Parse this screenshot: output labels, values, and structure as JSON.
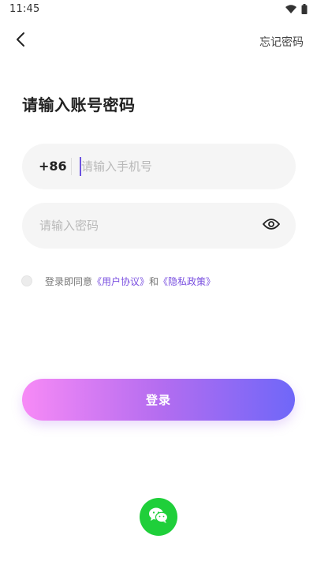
{
  "status_bar": {
    "time": "11:45",
    "wifi_icon": "wifi-icon",
    "battery_icon": "battery-icon"
  },
  "nav": {
    "back_icon": "chevron-left-icon",
    "forgot_password_label": "忘记密码"
  },
  "title": "请输入账号密码",
  "phone": {
    "country_code": "+86",
    "value": "",
    "placeholder": "请输入手机号"
  },
  "password": {
    "value": "",
    "placeholder": "请输入密码",
    "toggle_icon": "eye-icon"
  },
  "agreement": {
    "checked": false,
    "prefix": "登录即同意",
    "user_agreement": "《用户协议》",
    "conjunction": "和",
    "privacy_policy": "《隐私政策》"
  },
  "login_button_label": "登录",
  "wechat_login_icon": "wechat-icon",
  "colors": {
    "accent": "#7a4fe0",
    "gradient_start": "#f78af6",
    "gradient_end": "#6f67f8",
    "wechat_green": "#1fcf3a",
    "input_bg": "#f5f5f5"
  }
}
